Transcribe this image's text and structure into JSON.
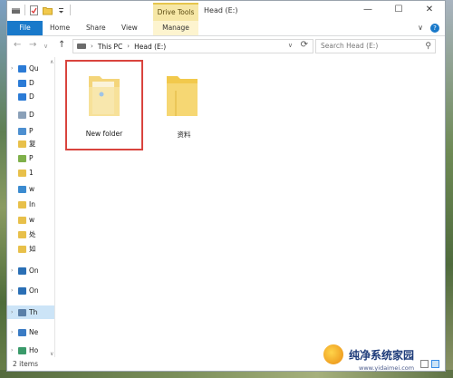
{
  "titlebar": {
    "context_tab": "Drive Tools",
    "title": "Head (E:)",
    "minimize": "—",
    "maximize": "☐",
    "close": "✕"
  },
  "ribbon": {
    "tabs": [
      {
        "label": "File"
      },
      {
        "label": "Home"
      },
      {
        "label": "Share"
      },
      {
        "label": "View"
      },
      {
        "label": "Manage"
      }
    ],
    "collapse": "∨",
    "help": "?"
  },
  "address": {
    "crumbs": [
      "This PC",
      "Head (E:)"
    ],
    "search_placeholder": "Search Head (E:)"
  },
  "navpane": {
    "items": [
      {
        "label": "Qu",
        "icon": "star-icon",
        "color": "#2b7bd6"
      },
      {
        "label": "D",
        "icon": "desktop-icon",
        "color": "#2b7bd6"
      },
      {
        "label": "D",
        "icon": "download-icon",
        "color": "#2b7bd6"
      },
      {
        "label": "D",
        "icon": "document-icon",
        "color": "#8aa0b8"
      },
      {
        "label": "P",
        "icon": "pictures-icon",
        "color": "#4d8fd0"
      },
      {
        "label": "复",
        "icon": "folder-icon",
        "color": "#e8c04a"
      },
      {
        "label": "P",
        "icon": "folder-icon",
        "color": "#7fb04a"
      },
      {
        "label": "1",
        "icon": "folder-icon",
        "color": "#e8c04a"
      },
      {
        "label": "w",
        "icon": "folder-icon",
        "color": "#3b8bd0"
      },
      {
        "label": "In",
        "icon": "folder-icon",
        "color": "#e8c04a"
      },
      {
        "label": "w",
        "icon": "folder-icon",
        "color": "#e8c04a"
      },
      {
        "label": "处",
        "icon": "folder-icon",
        "color": "#e8c04a"
      },
      {
        "label": "如",
        "icon": "folder-icon",
        "color": "#e8c04a"
      },
      {
        "label": "On",
        "icon": "cloud-icon",
        "color": "#2a6fb5"
      },
      {
        "label": "On",
        "icon": "cloud-icon",
        "color": "#2a6fb5"
      },
      {
        "label": "Th",
        "icon": "computer-icon",
        "color": "#5a7fa8"
      },
      {
        "label": "Ne",
        "icon": "network-icon",
        "color": "#3a7bc4"
      },
      {
        "label": "Ho",
        "icon": "homegroup-icon",
        "color": "#3a9a6a"
      }
    ]
  },
  "files": [
    {
      "name": "New folder"
    },
    {
      "name": "资料"
    }
  ],
  "status": {
    "count": "2 items"
  },
  "watermark": {
    "text": "纯净系统家园",
    "url": "www.yidaimei.com"
  }
}
